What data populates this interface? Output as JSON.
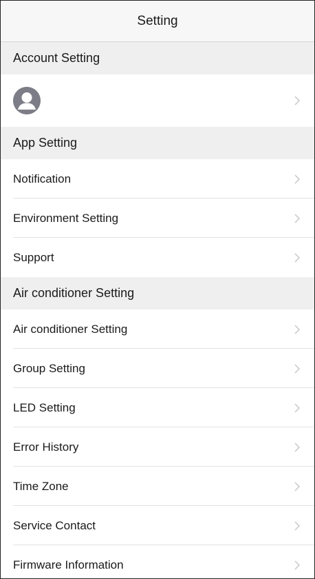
{
  "header": {
    "title": "Setting"
  },
  "sections": {
    "account": {
      "title": "Account Setting"
    },
    "app": {
      "title": "App Setting",
      "items": [
        "Notification",
        "Environment Setting",
        "Support"
      ]
    },
    "ac": {
      "title": "Air conditioner Setting",
      "items": [
        "Air conditioner Setting",
        "Group Setting",
        "LED Setting",
        "Error History",
        "Time Zone",
        "Service Contact",
        "Firmware Information"
      ]
    }
  },
  "icons": {
    "avatar": "user-avatar-icon",
    "chevron": "chevron-right-icon"
  },
  "colors": {
    "section_bg": "#efefef",
    "avatar_gray": "#7d7d87",
    "chevron_gray": "#c7c7cc"
  }
}
